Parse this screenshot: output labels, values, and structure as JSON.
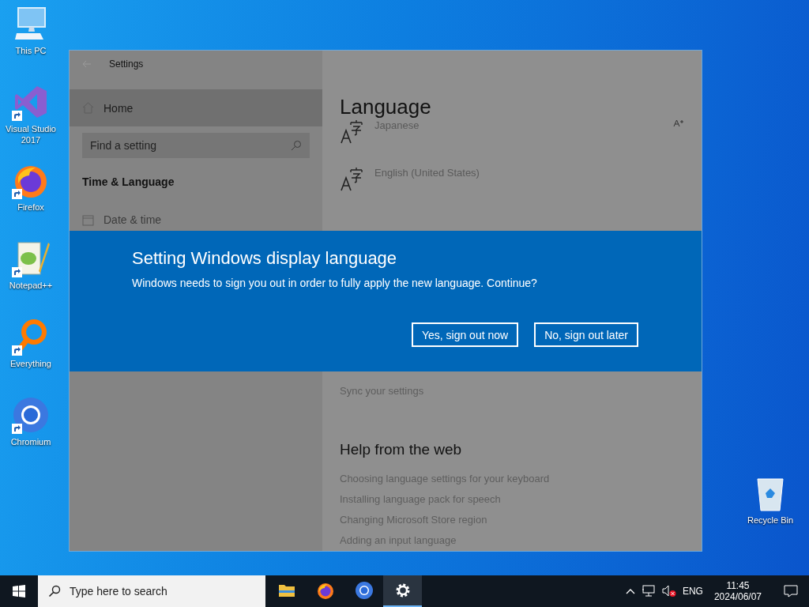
{
  "desktop_icons": [
    {
      "label": "This PC",
      "kind": "pc",
      "shortcut": false
    },
    {
      "label": "Visual Studio 2017",
      "kind": "vs",
      "shortcut": true
    },
    {
      "label": "Firefox",
      "kind": "firefox",
      "shortcut": true
    },
    {
      "label": "Notepad++",
      "kind": "notepad",
      "shortcut": true
    },
    {
      "label": "Everything",
      "kind": "everything",
      "shortcut": true
    },
    {
      "label": "Chromium",
      "kind": "chromium",
      "shortcut": true
    }
  ],
  "recycle_bin": {
    "label": "Recycle Bin",
    "kind": "recycle",
    "shortcut": false
  },
  "settings_window": {
    "title": "Settings",
    "sidebar": {
      "home": {
        "label": "Home",
        "selected": true
      },
      "search": {
        "placeholder": "Find a setting"
      },
      "section": "Time & Language",
      "items": [
        {
          "label": "Date & time",
          "selected": false
        }
      ]
    },
    "content": {
      "heading": "Language",
      "languages": [
        {
          "name": "Japanese",
          "font_icon": true
        },
        {
          "name": "English (United States)",
          "font_icon": false
        }
      ],
      "sync_link": "Sync your settings",
      "help_heading": "Help from the web",
      "help_links": [
        "Choosing language settings for your keyboard",
        "Installing language pack for speech",
        "Changing Microsoft Store region",
        "Adding an input language"
      ]
    }
  },
  "dialog": {
    "title": "Setting Windows display language",
    "message": "Windows needs to sign you out in order to fully apply the new language. Continue?",
    "buttons": [
      "Yes, sign out now",
      "No, sign out later"
    ]
  },
  "taskbar": {
    "search": {
      "placeholder": "Type here to search"
    },
    "apps": [
      {
        "kind": "explorer",
        "active": false
      },
      {
        "kind": "firefox",
        "active": false
      },
      {
        "kind": "chromium",
        "active": false
      },
      {
        "kind": "settings",
        "active": true
      }
    ],
    "language": "ENG",
    "time": "11:45",
    "date": "2024/06/07"
  }
}
